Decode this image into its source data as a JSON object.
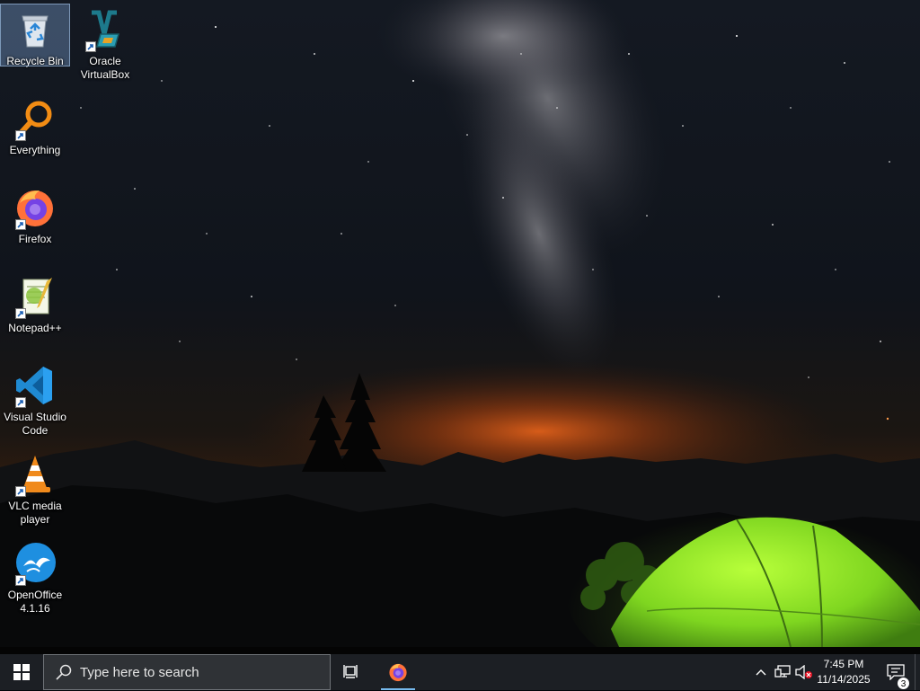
{
  "desktop": {
    "wallpaper": "night-sky-milky-way-tent",
    "icons": [
      {
        "label": "Recycle Bin",
        "icon": "recycle-bin-icon"
      },
      {
        "label": "Oracle\nVirtualBox",
        "icon": "virtualbox-icon"
      },
      {
        "label": "Everything",
        "icon": "everything-search-icon"
      },
      {
        "label": "Firefox",
        "icon": "firefox-icon"
      },
      {
        "label": "Notepad++",
        "icon": "notepad-plus-plus-icon"
      },
      {
        "label": "Visual Studio\nCode",
        "icon": "vscode-icon"
      },
      {
        "label": "VLC media\nplayer",
        "icon": "vlc-icon"
      },
      {
        "label": "OpenOffice\n4.1.16",
        "icon": "openoffice-icon"
      }
    ]
  },
  "taskbar": {
    "search_placeholder": "Type here to search",
    "pinned": [
      {
        "name": "Firefox",
        "icon": "firefox-icon",
        "active": true
      }
    ],
    "tray": {
      "time": "7:45 PM",
      "date": "11/14/2025",
      "notification_count": "3"
    },
    "colors": {
      "background": "#1c1f24",
      "accent": "#76b9ed"
    }
  }
}
